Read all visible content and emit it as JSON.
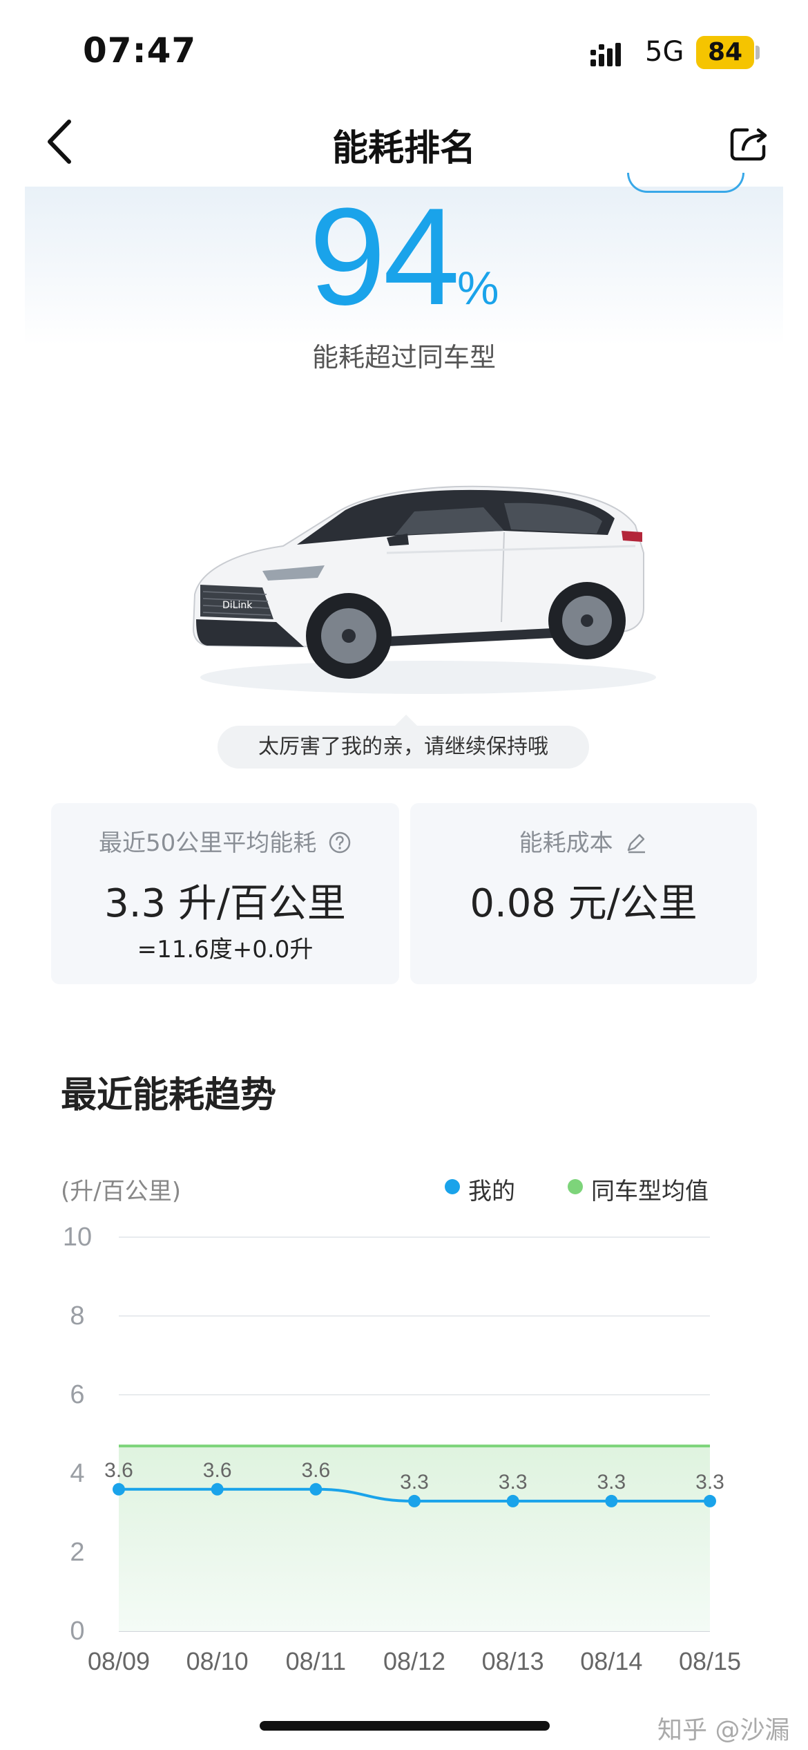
{
  "status_bar": {
    "time": "07:47",
    "network": "5G",
    "battery": "84"
  },
  "nav": {
    "title": "能耗排名"
  },
  "hero": {
    "percent_value": "94",
    "percent_unit": "%",
    "subtitle": "能耗超过同车型"
  },
  "car_image": {
    "badge_text": "DiLink"
  },
  "speech": "太厉害了我的亲，请继续保持哦",
  "cards": {
    "left": {
      "label": "最近50公里平均能耗",
      "value": "3.3 升/百公里",
      "sub": "=11.6度+0.0升"
    },
    "right": {
      "label": "能耗成本",
      "value": "0.08 元/公里"
    }
  },
  "trend": {
    "title": "最近能耗趋势",
    "unit": "(升/百公里)",
    "legend": {
      "mine": "我的",
      "avg": "同车型均值"
    }
  },
  "colors": {
    "accent": "#1aa3ea",
    "avg_line": "#7dd47a"
  },
  "chart_data": {
    "type": "line",
    "categories": [
      "08/09",
      "08/10",
      "08/11",
      "08/12",
      "08/13",
      "08/14",
      "08/15"
    ],
    "series": [
      {
        "name": "我的",
        "values": [
          3.6,
          3.6,
          3.6,
          3.3,
          3.3,
          3.3,
          3.3
        ],
        "labels": [
          "3.6",
          "3.6",
          "3.6",
          "3.3",
          "3.3",
          "3.3",
          "3.3"
        ]
      },
      {
        "name": "同车型均值",
        "values": [
          4.7,
          4.7,
          4.7,
          4.7,
          4.7,
          4.7,
          4.7
        ]
      }
    ],
    "ylim": [
      0,
      10
    ],
    "yticks": [
      "0",
      "2",
      "4",
      "6",
      "8",
      "10"
    ],
    "ylabel": "(升/百公里)",
    "grid": true,
    "legend_position": "top-right"
  },
  "watermark": "知乎 @沙漏"
}
